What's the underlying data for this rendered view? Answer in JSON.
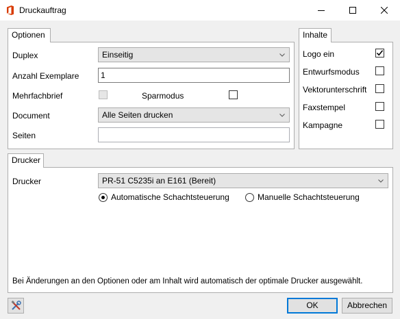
{
  "window": {
    "title": "Druckauftrag"
  },
  "options": {
    "tab_label": "Optionen",
    "duplex_label": "Duplex",
    "duplex_value": "Einseitig",
    "copies_label": "Anzahl Exemplare",
    "copies_value": "1",
    "multi_letter_label": "Mehrfachbrief",
    "multi_letter_checked": false,
    "economy_label": "Sparmodus",
    "economy_checked": false,
    "document_label": "Document",
    "document_value": "Alle Seiten drucken",
    "pages_label": "Seiten",
    "pages_value": ""
  },
  "contents": {
    "tab_label": "Inhalte",
    "items": [
      {
        "label": "Logo ein",
        "checked": true
      },
      {
        "label": "Entwurfsmodus",
        "checked": false
      },
      {
        "label": "Vektorunterschrift",
        "checked": false
      },
      {
        "label": "Faxstempel",
        "checked": false
      },
      {
        "label": "Kampagne",
        "checked": false
      }
    ]
  },
  "printer": {
    "tab_label": "Drucker",
    "printer_label": "Drucker",
    "printer_value": "PR-51 C5235i an E161 (Bereit)",
    "auto_tray_label": "Automatische Schachtsteuerung",
    "manual_tray_label": "Manuelle Schachtsteuerung",
    "selected_tray_mode": "auto",
    "info_text": "Bei Änderungen an den Optionen oder am Inhalt wird automatisch der optimale Drucker ausgewählt."
  },
  "buttons": {
    "ok": "OK",
    "cancel": "Abbrechen"
  },
  "icons": {
    "app": "office-icon",
    "minimize": "minimize-icon",
    "maximize": "maximize-icon",
    "close": "close-icon",
    "tools": "tools-icon",
    "dropdown": "chevron-down-icon",
    "check": "checkmark-icon"
  },
  "colors": {
    "app_icon": "#d83b01",
    "default_button_border": "#0078d7",
    "window_background": "#f0f0f0",
    "panel_background": "#ffffff"
  }
}
